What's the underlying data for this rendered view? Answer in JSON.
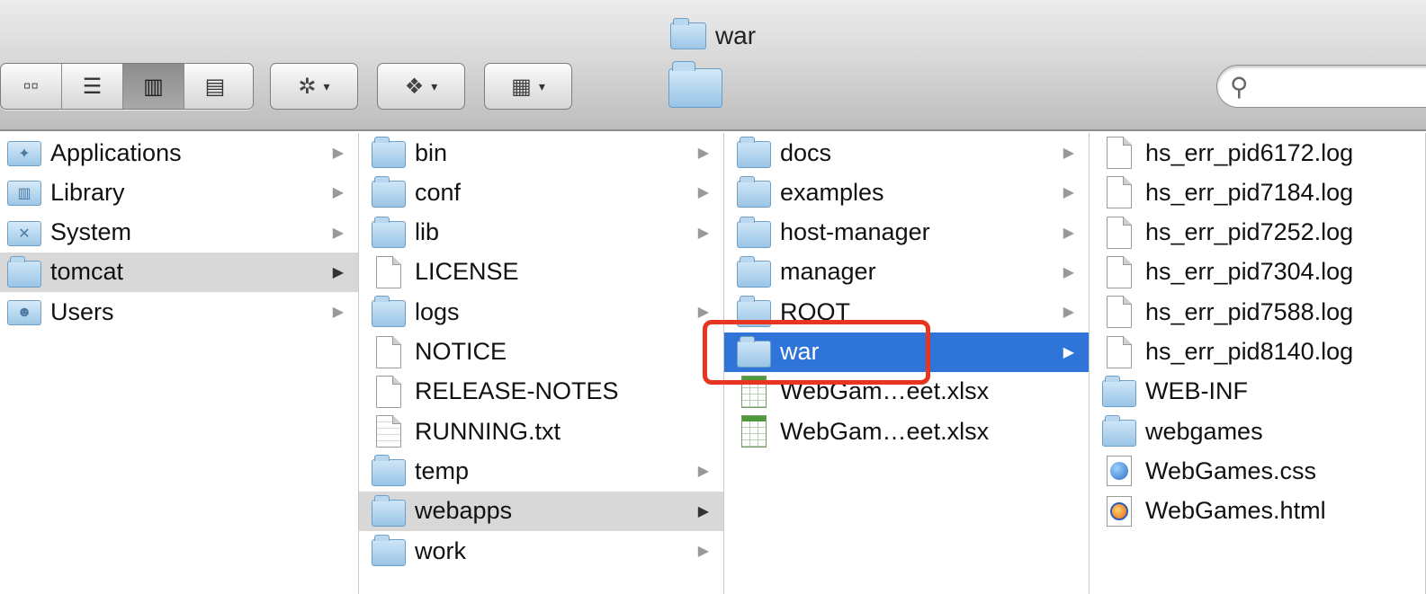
{
  "window": {
    "title": "war"
  },
  "toolbar": {
    "view_buttons": [
      {
        "name": "icon-view-button",
        "glyph": "▫▫",
        "active": false
      },
      {
        "name": "list-view-button",
        "glyph": "☰",
        "active": false
      },
      {
        "name": "column-view-button",
        "glyph": "▥",
        "active": true
      },
      {
        "name": "coverflow-view-button",
        "glyph": "▤",
        "active": false
      }
    ],
    "action_glyph": "✲",
    "dropbox_glyph": "❖",
    "arrange_glyph": "▦",
    "caret": "▾",
    "search_placeholder": "",
    "search_glyph": "⚲"
  },
  "columns": [
    {
      "name": "column-root",
      "items": [
        {
          "label": "Applications",
          "icon": "apps",
          "arrow": true,
          "selected": ""
        },
        {
          "label": "Library",
          "icon": "library",
          "arrow": true,
          "selected": ""
        },
        {
          "label": "System",
          "icon": "system",
          "arrow": true,
          "selected": ""
        },
        {
          "label": "tomcat",
          "icon": "folder",
          "arrow": true,
          "selected": "gray"
        },
        {
          "label": "Users",
          "icon": "users",
          "arrow": true,
          "selected": ""
        }
      ]
    },
    {
      "name": "column-tomcat",
      "items": [
        {
          "label": "bin",
          "icon": "folder",
          "arrow": true,
          "selected": ""
        },
        {
          "label": "conf",
          "icon": "folder",
          "arrow": true,
          "selected": ""
        },
        {
          "label": "lib",
          "icon": "folder",
          "arrow": true,
          "selected": ""
        },
        {
          "label": "LICENSE",
          "icon": "doc",
          "arrow": false,
          "selected": ""
        },
        {
          "label": "logs",
          "icon": "folder",
          "arrow": true,
          "selected": ""
        },
        {
          "label": "NOTICE",
          "icon": "doc",
          "arrow": false,
          "selected": ""
        },
        {
          "label": "RELEASE-NOTES",
          "icon": "doc",
          "arrow": false,
          "selected": ""
        },
        {
          "label": "RUNNING.txt",
          "icon": "txt",
          "arrow": false,
          "selected": ""
        },
        {
          "label": "temp",
          "icon": "folder",
          "arrow": true,
          "selected": ""
        },
        {
          "label": "webapps",
          "icon": "folder",
          "arrow": true,
          "selected": "gray"
        },
        {
          "label": "work",
          "icon": "folder",
          "arrow": true,
          "selected": ""
        }
      ]
    },
    {
      "name": "column-webapps",
      "items": [
        {
          "label": "docs",
          "icon": "folder",
          "arrow": true,
          "selected": ""
        },
        {
          "label": "examples",
          "icon": "folder",
          "arrow": true,
          "selected": ""
        },
        {
          "label": "host-manager",
          "icon": "folder",
          "arrow": true,
          "selected": ""
        },
        {
          "label": "manager",
          "icon": "folder",
          "arrow": true,
          "selected": ""
        },
        {
          "label": "ROOT",
          "icon": "folder",
          "arrow": true,
          "selected": ""
        },
        {
          "label": "war",
          "icon": "folder",
          "arrow": true,
          "selected": "blue"
        },
        {
          "label": "WebGam…eet.xlsx",
          "icon": "sheet",
          "arrow": false,
          "selected": ""
        },
        {
          "label": "WebGam…eet.xlsx",
          "icon": "sheet",
          "arrow": false,
          "selected": ""
        }
      ]
    },
    {
      "name": "column-war",
      "items": [
        {
          "label": "hs_err_pid6172.log",
          "icon": "doc",
          "arrow": false,
          "selected": ""
        },
        {
          "label": "hs_err_pid7184.log",
          "icon": "doc",
          "arrow": false,
          "selected": ""
        },
        {
          "label": "hs_err_pid7252.log",
          "icon": "doc",
          "arrow": false,
          "selected": ""
        },
        {
          "label": "hs_err_pid7304.log",
          "icon": "doc",
          "arrow": false,
          "selected": ""
        },
        {
          "label": "hs_err_pid7588.log",
          "icon": "doc",
          "arrow": false,
          "selected": ""
        },
        {
          "label": "hs_err_pid8140.log",
          "icon": "doc",
          "arrow": false,
          "selected": ""
        },
        {
          "label": "WEB-INF",
          "icon": "folder",
          "arrow": false,
          "selected": ""
        },
        {
          "label": "webgames",
          "icon": "folder",
          "arrow": false,
          "selected": ""
        },
        {
          "label": "WebGames.css",
          "icon": "css",
          "arrow": false,
          "selected": ""
        },
        {
          "label": "WebGames.html",
          "icon": "html",
          "arrow": false,
          "selected": ""
        }
      ]
    }
  ],
  "colors": {
    "selection_blue": "#2f74d8",
    "selection_gray": "#d8d8d8",
    "highlight_red": "#e8351f"
  }
}
